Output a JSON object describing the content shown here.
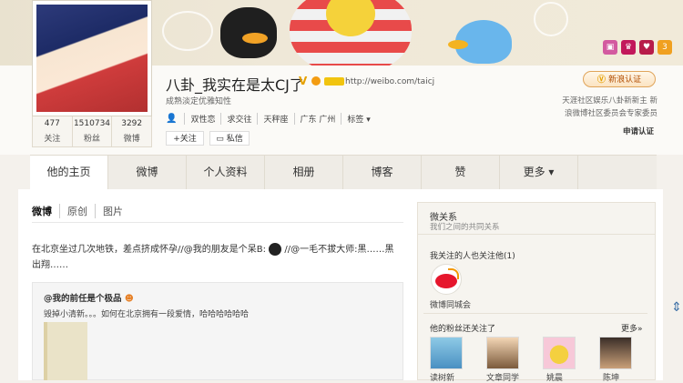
{
  "profile": {
    "name": "八卦_我实在是太CJ了",
    "url": "http://weibo.com/taicj",
    "signature": "成熟淡定优雅知性",
    "tags": [
      "双性恋",
      "求交往",
      "天秤座",
      "广东 广州",
      "标签 ▾"
    ],
    "follow_label": "+关注",
    "message_label": "私信",
    "stats": [
      {
        "value": "477",
        "label": "关注"
      },
      {
        "value": "1510734",
        "label": "粉丝"
      },
      {
        "value": "3292",
        "label": "微博"
      }
    ],
    "verify_button": "新浪认证",
    "verify_desc": [
      "天涯社区娱乐八卦新新主 新",
      "浪微博社区委员会专家委员"
    ],
    "apply_link": "申请认证",
    "v_mark": "V",
    "top_icon_badge": "3"
  },
  "tabs": [
    "他的主页",
    "微博",
    "个人资料",
    "相册",
    "博客",
    "赞",
    "更多 ▾"
  ],
  "subtabs": [
    "微博",
    "原创",
    "图片"
  ],
  "post": {
    "text_lines": [
      "在北京坐过几次地铁，差点挤成怀孕//@我的朋友是个呆B:",
      "//@一毛不拔大师:黑……黑",
      "出翔……"
    ],
    "repost_author": "@我的前任是个极品",
    "repost_text": "毁掉小清新。。。如何在北京拥有一段爱情，哈哈哈哈哈哈"
  },
  "sidebar": {
    "title": "微关系",
    "subtitle": "我们之间的共同关系",
    "followed_by_heading": "我关注的人也关注他(1)",
    "followed_by_name": "微博同城会",
    "fans_heading": "他的粉丝还关注了",
    "more": "更多»",
    "fans": [
      "读树新",
      "文章同学",
      "姚晨",
      "陈坤"
    ]
  },
  "colors": {
    "accent": "#e6162d",
    "link": "#3a6ea5",
    "background": "#f4f1ec"
  }
}
